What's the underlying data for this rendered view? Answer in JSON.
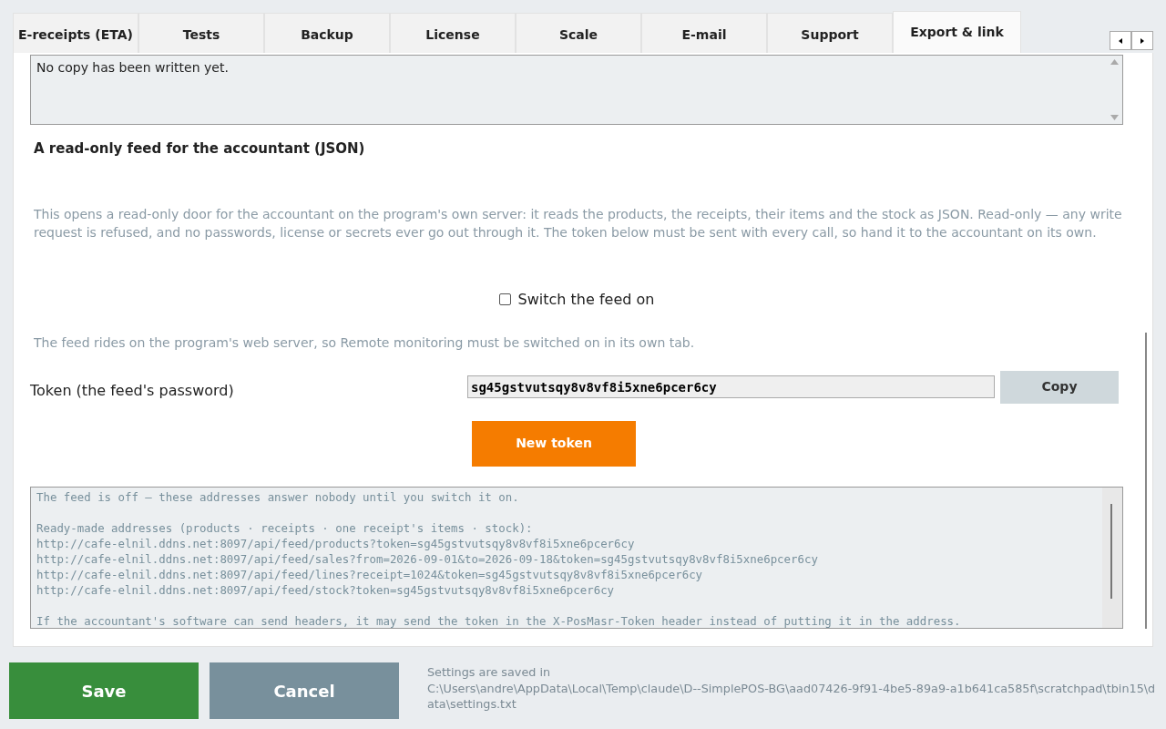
{
  "tabs": [
    {
      "label": "E-receipts (ETA)",
      "selected": false
    },
    {
      "label": "Tests",
      "selected": false
    },
    {
      "label": "Backup",
      "selected": false
    },
    {
      "label": "License",
      "selected": false
    },
    {
      "label": "Scale",
      "selected": false
    },
    {
      "label": "E-mail",
      "selected": false
    },
    {
      "label": "Support",
      "selected": false
    },
    {
      "label": "Export & link",
      "selected": true
    }
  ],
  "copy_log": {
    "text": "No copy has been written yet."
  },
  "feed": {
    "heading": "A read-only feed for the accountant (JSON)",
    "description": "This opens a read-only door for the accountant on the program's own server: it reads the products, the receipts, their items and the stock as JSON. Read-only — any write request is refused, and no passwords, license or secrets ever go out through it. The token below must be sent with every call, so hand it to the accountant on its own.",
    "switch": {
      "label": "Switch the feed on",
      "checked": false
    },
    "note": "The feed rides on the program's web server, so Remote monitoring must be switched on in its own tab.",
    "token_label": "Token (the feed's password)",
    "token_value": "sg45gstvutsqy8v8vf8i5xne6pcer6cy",
    "copy_button": "Copy",
    "new_token_button": "New token",
    "addresses": {
      "status": "The feed is off — these addresses answer nobody until you switch it on.",
      "heading": "Ready-made addresses (products · receipts · one receipt's items · stock):",
      "urls": [
        "http://cafe-elnil.ddns.net:8097/api/feed/products?token=sg45gstvutsqy8v8vf8i5xne6pcer6cy",
        "http://cafe-elnil.ddns.net:8097/api/feed/sales?from=2026-09-01&to=2026-09-18&token=sg45gstvutsqy8v8vf8i5xne6pcer6cy",
        "http://cafe-elnil.ddns.net:8097/api/feed/lines?receipt=1024&token=sg45gstvutsqy8v8vf8i5xne6pcer6cy",
        "http://cafe-elnil.ddns.net:8097/api/feed/stock?token=sg45gstvutsqy8v8vf8i5xne6pcer6cy"
      ],
      "header_hint": "If the accountant's software can send headers, it may send the token in the X-PosMasr-Token header instead of putting it in the address."
    }
  },
  "footer": {
    "save": "Save",
    "cancel": "Cancel",
    "saved_in_label": "Settings are saved in",
    "saved_in_path": "C:\\Users\\andre\\AppData\\Local\\Temp\\claude\\D--SimplePOS-BG\\aad07426-9f91-4be5-89a9-a1b641ca585f\\scratchpad\\tbin15\\data\\settings.txt"
  }
}
